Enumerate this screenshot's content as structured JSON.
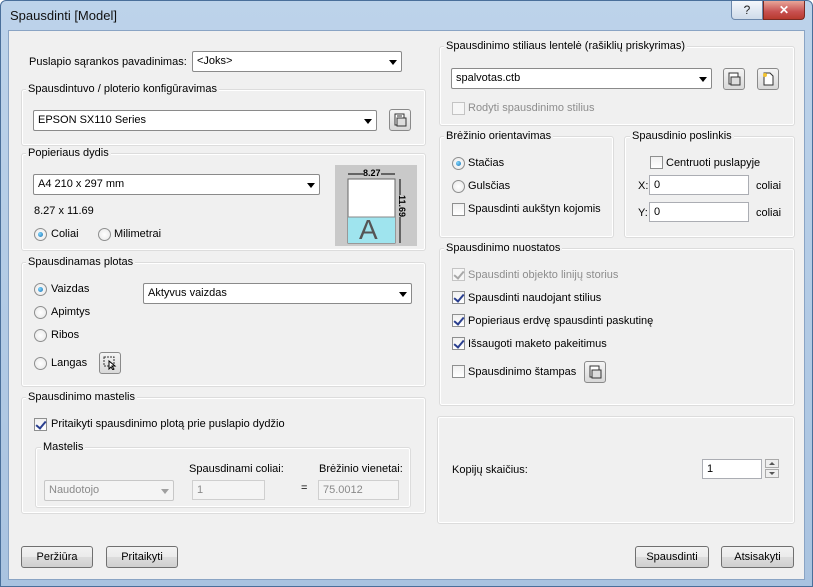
{
  "window": {
    "title": "Spausdinti [Model]",
    "help_label": "?",
    "close_label": "✕"
  },
  "left": {
    "page_setup_name_label": "Puslapio sąrankos pavadinimas:",
    "page_setup_name_value": "<Joks>",
    "printer_group": "Spausdintuvo / ploterio konfigūravimas",
    "printer_value": "EPSON SX110 Series",
    "paper_group": "Popieriaus dydis",
    "paper_value": "A4 210 x 297 mm",
    "paper_dims": "8.27 x 11.69",
    "preview_width": "8.27",
    "preview_height": "11.69",
    "preview_letter": "A",
    "unit_inches": "Coliai",
    "unit_mm": "Milimetrai",
    "area_group": "Spausdinamas plotas",
    "area_options": [
      "Vaizdas",
      "Apimtys",
      "Ribos",
      "Langas"
    ],
    "area_view_value": "Aktyvus vaizdas",
    "scale_group": "Spausdinimo mastelis",
    "fit_label": "Pritaikyti spausdinimo plotą prie puslapio dydžio",
    "scale_sub": "Mastelis",
    "scale_value": "Naudotojo",
    "inches_label": "Spausdinami coliai:",
    "inches_value": "1",
    "equals": "=",
    "units_label": "Brėžinio vienetai:",
    "units_value": "75.0012"
  },
  "right": {
    "style_group": "Spausdinimo stiliaus lentelė (rašiklių priskyrimas)",
    "style_value": "spalvotas.ctb",
    "show_styles": "Rodyti spausdinimo stilius",
    "orient_group": "Brėžinio orientavimas",
    "orient_options": [
      "Stačias",
      "Gulsčias"
    ],
    "upside_down": "Spausdinti aukštyn kojomis",
    "offset_group": "Spausdinio poslinkis",
    "center_label": "Centruoti puslapyje",
    "x_label": "X:",
    "x_value": "0",
    "y_label": "Y:",
    "y_value": "0",
    "offset_unit": "coliai",
    "options_group": "Spausdinimo nuostatos",
    "options": [
      "Spausdinti objekto linijų storius",
      "Spausdinti naudojant stilius",
      "Popieriaus erdvę spausdinti paskutinę",
      "Išsaugoti maketo pakeitimus",
      "Spausdinimo štampas"
    ],
    "copies_label": "Kopijų skaičius:",
    "copies_value": "1"
  },
  "buttons": {
    "preview": "Peržiūra",
    "apply": "Pritaikyti",
    "print": "Spausdinti",
    "cancel": "Atsisakyti"
  }
}
